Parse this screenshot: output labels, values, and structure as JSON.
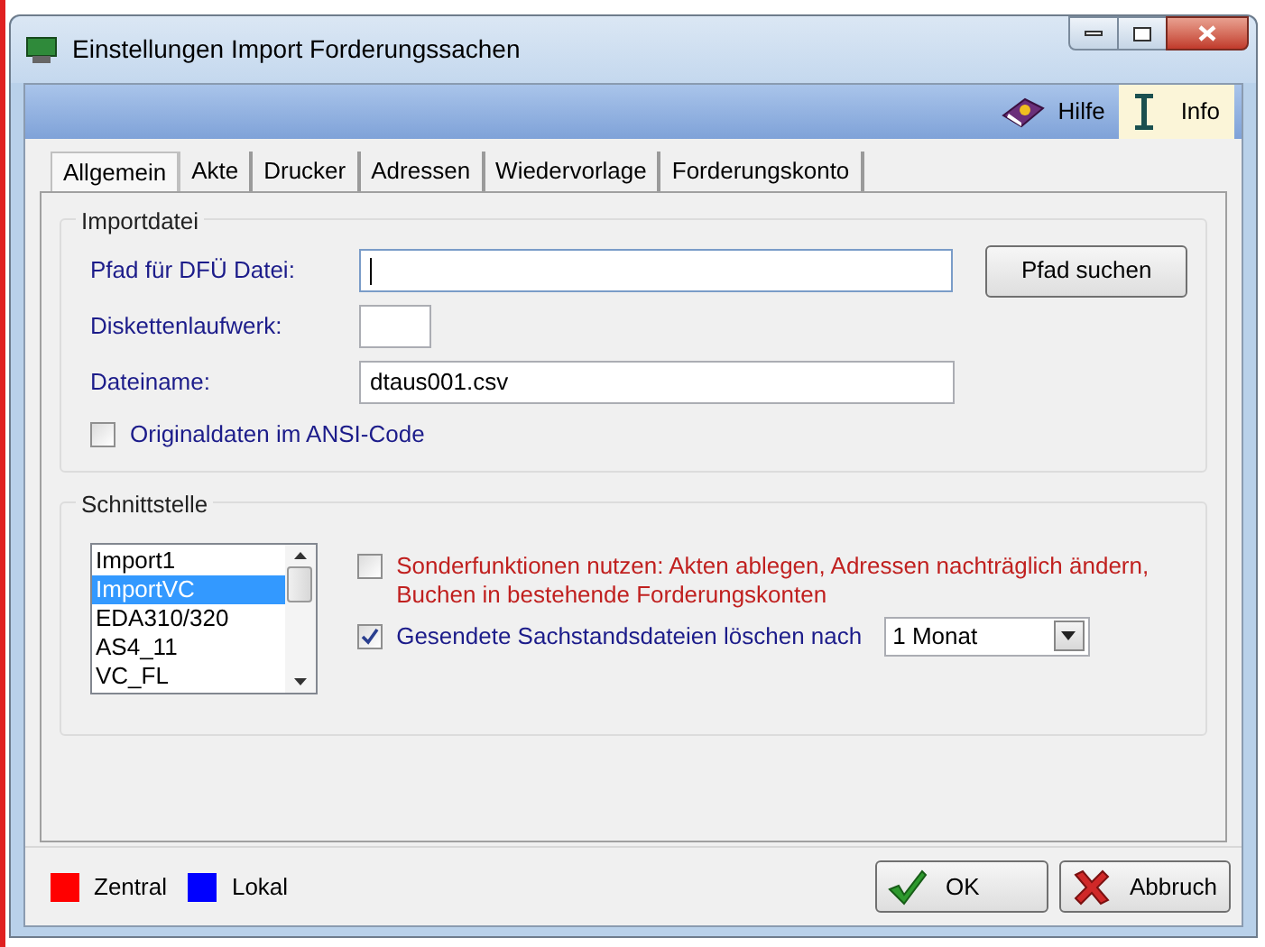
{
  "window": {
    "title": "Einstellungen Import Forderungssachen"
  },
  "toolbar": [
    {
      "label": "Hilfe",
      "kind": "help",
      "highlighted": false
    },
    {
      "label": "Info",
      "kind": "info",
      "highlighted": true
    }
  ],
  "tabs": [
    {
      "label": "Allgemein",
      "selected": true
    },
    {
      "label": "Akte",
      "selected": false
    },
    {
      "label": "Drucker",
      "selected": false
    },
    {
      "label": "Adressen",
      "selected": false
    },
    {
      "label": "Wiedervorlage",
      "selected": false
    },
    {
      "label": "Forderungskonto",
      "selected": false
    }
  ],
  "import_group": {
    "title": "Importdatei",
    "fields": [
      {
        "label": "Pfad für DFÜ Datei:",
        "kind": "wide",
        "focused": true
      },
      {
        "label": "Diskettenlaufwerk:",
        "kind": "short",
        "focused": false
      },
      {
        "label": "Dateiname:",
        "value": "dtaus001.csv",
        "kind": "wide",
        "focused": false
      }
    ],
    "browse_button": "Pfad suchen",
    "checkbox": {
      "label": "Originaldaten im ANSI-Code",
      "checked": false
    }
  },
  "interface_group": {
    "title": "Schnittstelle",
    "list": [
      {
        "label": "Import1",
        "selected": false
      },
      {
        "label": "ImportVC",
        "selected": true
      },
      {
        "label": "EDA310/320",
        "selected": false
      },
      {
        "label": "AS4_11",
        "selected": false
      },
      {
        "label": "VC_FL",
        "selected": false
      }
    ],
    "options": [
      {
        "label": "Sonderfunktionen nutzen: Akten ablegen, Adressen nachträglich ändern, Buchen in bestehende Forderungskonten",
        "checked": false,
        "color": "#c0201f"
      },
      {
        "label": "Gesendete Sachstandsdateien löschen nach",
        "checked": true,
        "color": "#1c1c8a",
        "dropdown": "1 Monat"
      }
    ]
  },
  "legend": [
    {
      "label": "Zentral",
      "color": "#ff0000"
    },
    {
      "label": "Lokal",
      "color": "#0000ff"
    }
  ],
  "buttons": [
    {
      "label": "OK",
      "kind": "ok"
    },
    {
      "label": "Abbruch",
      "kind": "cancel"
    }
  ]
}
